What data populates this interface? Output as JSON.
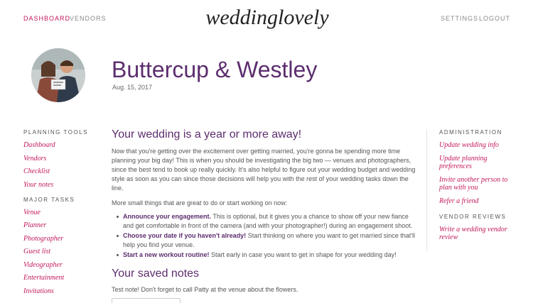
{
  "nav": {
    "dashboard": "Dashboard",
    "vendors": "Vendors",
    "settings": "Settings",
    "logout": "Logout"
  },
  "logo": {
    "text": "weddinglovely",
    "color": "#222222"
  },
  "profile": {
    "couple_name": "Buttercup & Westley",
    "date": "Aug. 15, 2017",
    "photo_icon": "couple-photo"
  },
  "left_sidebar": {
    "planning_heading": "Planning Tools",
    "planning_items": [
      "Dashboard",
      "Vendors",
      "Checklist",
      "Your notes"
    ],
    "tasks_heading": "Major Tasks",
    "task_items": [
      "Venue",
      "Planner",
      "Photographer",
      "Guest list",
      "Videographer",
      "Entertainment",
      "Invitations"
    ]
  },
  "main": {
    "heading": "Your wedding is a year or more away!",
    "intro": "Now that you're getting over the excitement over getting married, you're gonna be spending more time planning your big day! This is when you should be investigating the big two — venues and photographers, since the best tend to book up really quickly. It's also helpful to figure out your wedding budget and wedding style as soon as you can since those decisions will help you with the rest of your wedding tasks down the line.",
    "more": "More small things that are great to do or start working on now:",
    "tasks": [
      {
        "title": "Announce your engagement.",
        "text": " This is optional, but it gives you a chance to show off your new fiance and get comfortable in front of the camera (and with your photographer!) during an engagement shoot."
      },
      {
        "title": "Choose your date if you haven't already!",
        "text": " Start thinking on where you want to get married since that'll help you find your venue."
      },
      {
        "title": "Start a new workout routine!",
        "text": " Start early in case you want to get in shape for your wedding day!"
      }
    ]
  },
  "notes": {
    "heading": "Your saved notes",
    "text": "Test note! Don't forget to call Patty at the venue about the flowers."
  },
  "right_sidebar": {
    "admin_heading": "Administration",
    "admin_items": [
      "Update wedding info",
      "Update planning preferences",
      "Invite another person to plan with you",
      "Refer a friend"
    ],
    "reviews_heading": "Vendor Reviews",
    "review_items": [
      "Write a wedding vendor review"
    ]
  },
  "colors": {
    "accent": "#c2185b",
    "brand": "#5c2d6e"
  }
}
